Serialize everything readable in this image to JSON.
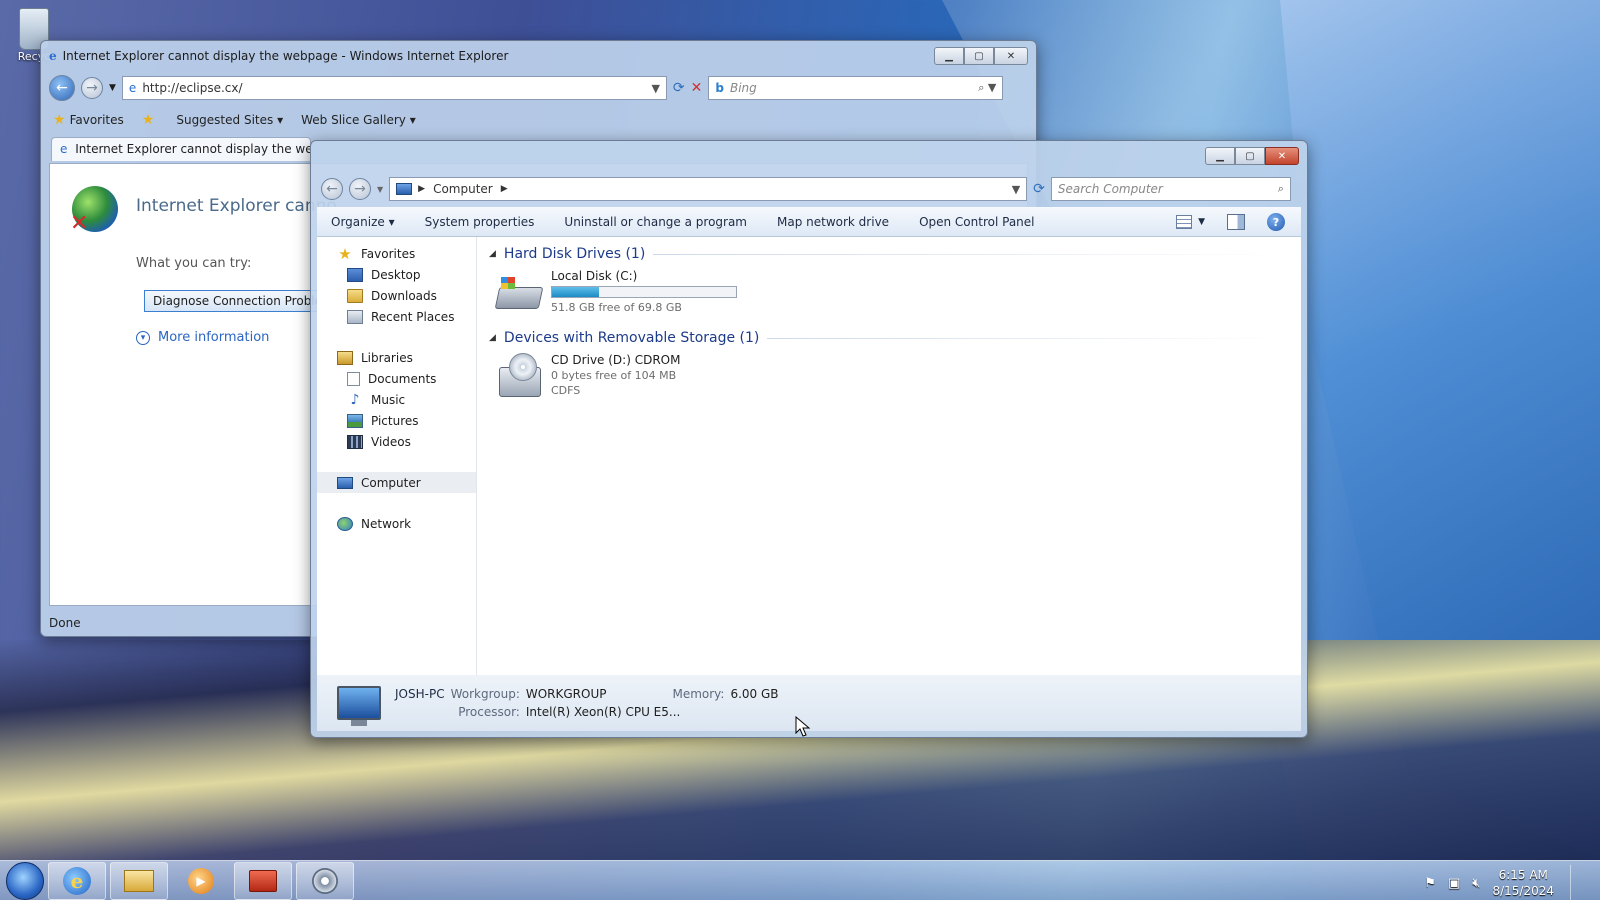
{
  "desktop": {
    "recycle_label": "Recyc"
  },
  "ie": {
    "title": "Internet Explorer cannot display the webpage - Windows Internet Explorer",
    "address": "http://eclipse.cx/",
    "search_placeholder": "Bing",
    "favorites_label": "Favorites",
    "suggested_sites": "Suggested Sites",
    "web_slice_gallery": "Web Slice Gallery",
    "tab_title": "Internet Explorer cannot display the webpage",
    "headline": "Internet Explorer canno",
    "what_you_can_try": "What you can try:",
    "diagnose_button": "Diagnose Connection Proble",
    "more_information": "More information",
    "status": "Done"
  },
  "explorer": {
    "breadcrumb": "Computer",
    "search_placeholder": "Search Computer",
    "toolbar": {
      "organize": "Organize",
      "system_properties": "System properties",
      "uninstall": "Uninstall or change a program",
      "map_drive": "Map network drive",
      "control_panel": "Open Control Panel"
    },
    "sidebar": {
      "favorites": "Favorites",
      "desktop": "Desktop",
      "downloads": "Downloads",
      "recent_places": "Recent Places",
      "libraries": "Libraries",
      "documents": "Documents",
      "music": "Music",
      "pictures": "Pictures",
      "videos": "Videos",
      "computer": "Computer",
      "network": "Network"
    },
    "groups": {
      "hdd_header": "Hard Disk Drives (1)",
      "removable_header": "Devices with Removable Storage (1)"
    },
    "drives": {
      "local_name": "Local Disk (C:)",
      "local_free": "51.8 GB free of 69.8 GB",
      "local_used_fraction": 0.258,
      "cd_name": "CD Drive (D:) CDROM",
      "cd_free": "0 bytes free of 104 MB",
      "cd_fs": "CDFS"
    },
    "details": {
      "pc_name": "JOSH-PC",
      "workgroup_label": "Workgroup:",
      "workgroup": "WORKGROUP",
      "memory_label": "Memory:",
      "memory": "6.00 GB",
      "processor_label": "Processor:",
      "processor": "Intel(R) Xeon(R) CPU E5..."
    }
  },
  "taskbar": {
    "time": "6:15 AM",
    "date": "8/15/2024"
  }
}
